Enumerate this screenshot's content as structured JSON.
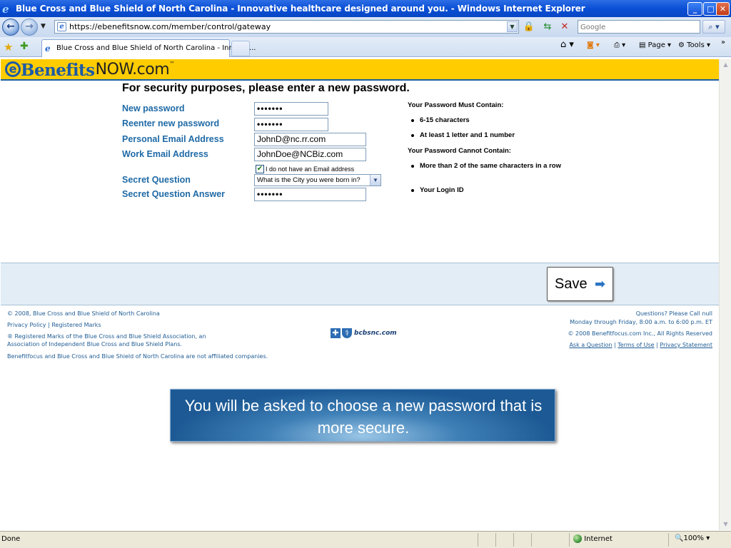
{
  "window": {
    "title": "Blue Cross and Blue Shield of North Carolina - Innovative healthcare designed around you. - Windows Internet Explorer",
    "min": "_",
    "max": "□",
    "close": "✕"
  },
  "address_bar": {
    "back": "←",
    "forward": "→",
    "url": "https://ebenefitsnow.com/member/control/gateway",
    "search_placeholder": "Google"
  },
  "tabs": [
    {
      "label": "Blue Cross and Blue Shield of North Carolina - Innovat..."
    }
  ],
  "command_bar": {
    "page": "Page",
    "tools": "Tools"
  },
  "brand": {
    "prefix": "Benefits",
    "suffix": "NOW.com",
    "tm": "™"
  },
  "form": {
    "heading": "For security purposes, please enter a new password.",
    "fields": [
      {
        "label": "New password",
        "value": "•••••••"
      },
      {
        "label": "Reenter new password",
        "value": "•••••••"
      },
      {
        "label": "Personal Email Address",
        "value": "JohnD@nc.rr.com"
      },
      {
        "label": "Work Email Address",
        "value": "JohnDoe@NCBiz.com"
      },
      {
        "label": "Secret Question",
        "value": "What is the City you were born in?"
      },
      {
        "label": "Secret Question Answer",
        "value": "•••••••"
      }
    ],
    "no_email_checkbox": {
      "label": "I do not have an Email address",
      "checked": true
    }
  },
  "rules": {
    "must_heading": "Your Password Must Contain:",
    "must_items": [
      "6-15 characters",
      "At least 1 letter and 1 number"
    ],
    "cannot_heading": "Your Password Cannot Contain:",
    "cannot_items": [
      "More than 2 of the same characters in a row",
      "Your Login ID"
    ]
  },
  "save_button": {
    "label": "Save",
    "arrow": "➡"
  },
  "footer": {
    "copyright": "© 2008, Blue Cross and Blue Shield of North Carolina",
    "privacy_policy": "Privacy Policy",
    "registered_marks": "Registered Marks",
    "registered_note_1": "® Registered Marks of the Blue Cross and Blue Shield Association, an",
    "registered_note_2": "Association of Independent Blue Cross and Blue Shield Plans.",
    "affiliation": "Benefitfocus and Blue Cross and Blue Shield of North Carolina are not affiliated companies.",
    "logo_text": "bcbsnc.com",
    "questions": "Questions? Please Call null",
    "hours": "Monday through Friday, 8:00 a.m. to 6:00 p.m. ET",
    "benefitfocus_copyright": "© 2008 Benefitfocus.com Inc., All Rights Reserved",
    "ask_question": "Ask a Question",
    "terms": "Terms of Use",
    "privacy_statement": "Privacy Statement",
    "separator": "|"
  },
  "callout": {
    "text": "You will be asked to choose a new password that is more secure."
  },
  "status_bar": {
    "status": "Done",
    "zone": "Internet",
    "zoom": "100%"
  }
}
